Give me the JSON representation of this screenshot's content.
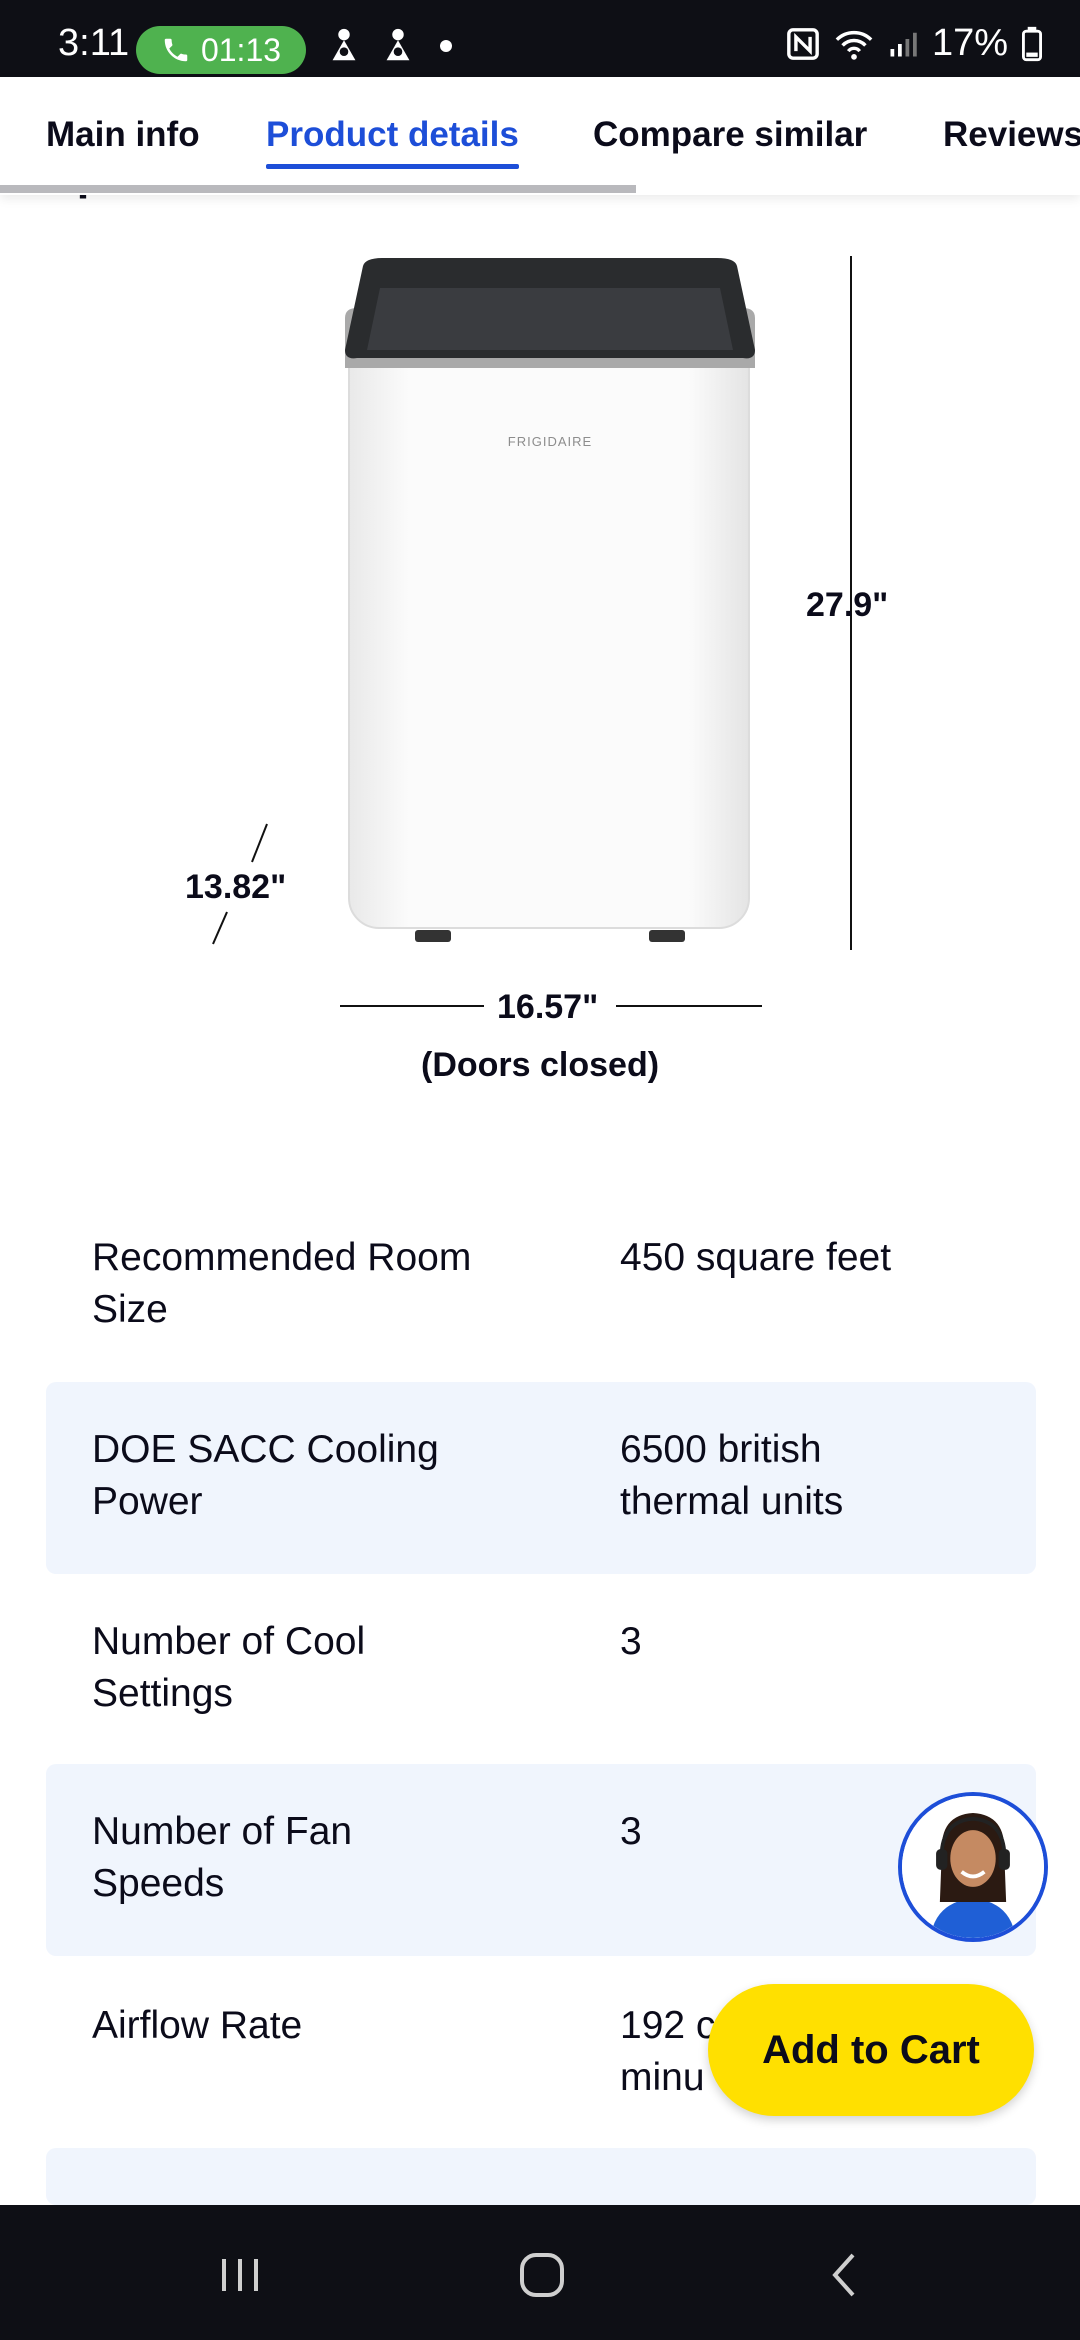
{
  "status_bar": {
    "time": "3:11",
    "call_timer": "01:13",
    "battery": "17%",
    "icons": [
      "phone-icon",
      "notification-icon",
      "notification-icon",
      "dot-icon",
      "nfc-icon",
      "wifi-icon",
      "signal-icon",
      "battery-icon"
    ]
  },
  "tabs": [
    {
      "label": "Main info",
      "active": false
    },
    {
      "label": "Product details",
      "active": true
    },
    {
      "label": "Compare similar",
      "active": false
    },
    {
      "label": "Reviews",
      "active": false
    }
  ],
  "section_heading": "Specifications",
  "product": {
    "brand": "FRIGIDAIRE",
    "height": "27.9\"",
    "depth": "13.82\"",
    "width": "16.57\"",
    "width_note": "(Doors closed)"
  },
  "specs": [
    {
      "label": "Recommended Room Size",
      "value": "450 square feet"
    },
    {
      "label": "DOE SACC Cooling Power",
      "value": "6500 british thermal units"
    },
    {
      "label": "Number of Cool Settings",
      "value": "3"
    },
    {
      "label": "Number of Fan Speeds",
      "value": "3"
    },
    {
      "label": "Airflow Rate",
      "value": "192 c\nminu"
    }
  ],
  "cta": {
    "add_to_cart": "Add to Cart"
  },
  "colors": {
    "accent": "#1d4ed8",
    "cta": "#ffe000",
    "row_shade": "#f0f5fd"
  }
}
